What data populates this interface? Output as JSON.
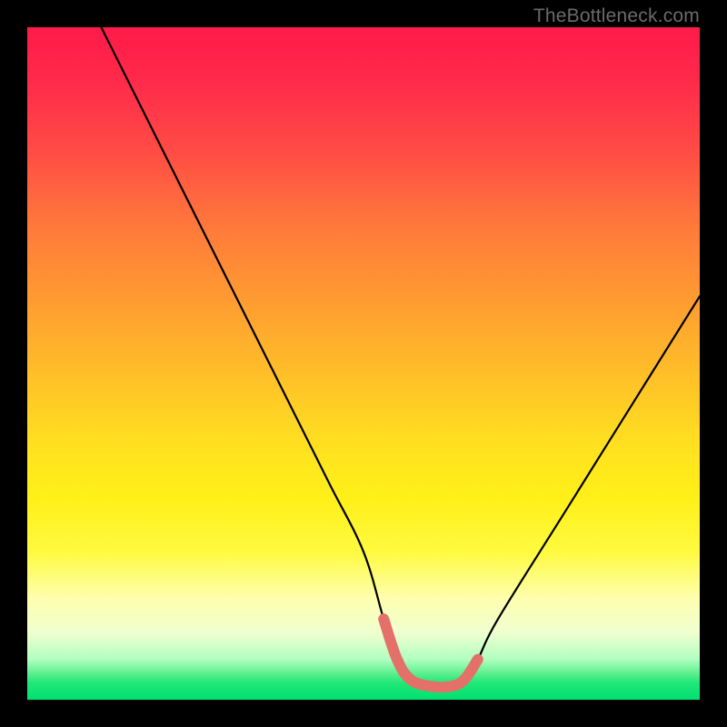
{
  "watermark": "TheBottleneck.com",
  "chart_data": {
    "type": "line",
    "title": "",
    "xlabel": "",
    "ylabel": "",
    "xlim": [
      0,
      100
    ],
    "ylim": [
      0,
      100
    ],
    "series": [
      {
        "name": "curve",
        "x": [
          11,
          20,
          30,
          40,
          45,
          50,
          53,
          55,
          57,
          60,
          63,
          65,
          67,
          70,
          80,
          90,
          100
        ],
        "values": [
          100,
          82,
          62,
          42,
          32,
          22,
          12,
          6,
          3,
          2,
          2,
          3,
          6,
          12,
          28,
          44,
          60
        ]
      }
    ],
    "grid": false,
    "legend": false,
    "annotations": [
      {
        "name": "valley-highlight",
        "x": [
          53,
          55,
          57,
          60,
          63,
          65,
          67
        ],
        "values": [
          12,
          6,
          3,
          2,
          2,
          3,
          6
        ],
        "color": "#e3716a",
        "width": 12
      }
    ],
    "colors": {
      "background_black": "#000000",
      "curve_stroke": "#000000",
      "highlight_stroke": "#e3716a",
      "gradient_top": "#ff1a4a",
      "gradient_bottom": "#00e070"
    }
  }
}
